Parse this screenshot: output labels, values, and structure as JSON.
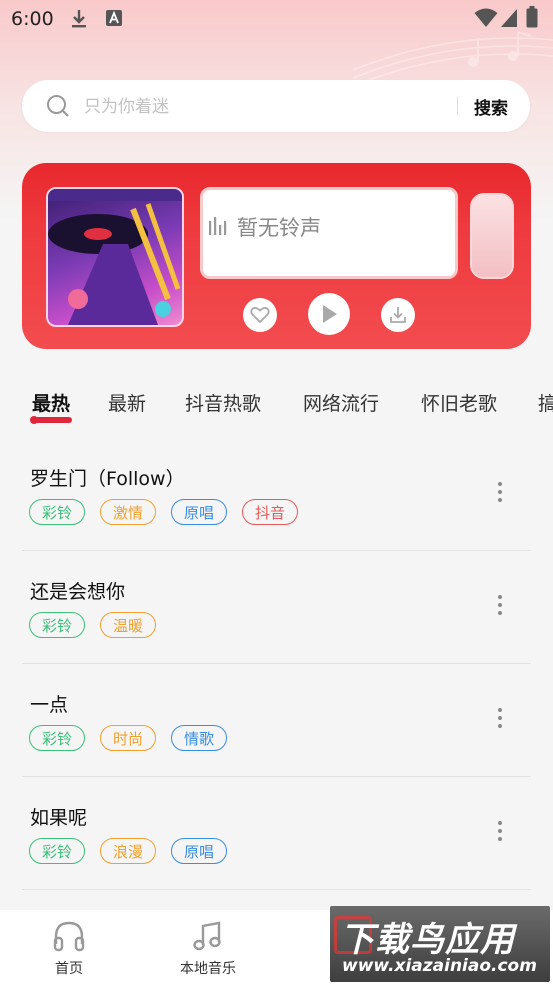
{
  "status": {
    "time": "6:00"
  },
  "search": {
    "placeholder": "只为你着迷",
    "button_label": "搜索"
  },
  "player": {
    "now_playing": "暂无铃声"
  },
  "tabs": [
    "最热",
    "最新",
    "抖音热歌",
    "网络流行",
    "怀旧老歌",
    "搞"
  ],
  "active_tab": 0,
  "songs": [
    {
      "title": "罗生门（Follow）",
      "tags": [
        "彩铃",
        "激情",
        "原唱",
        "抖音"
      ]
    },
    {
      "title": "还是会想你",
      "tags": [
        "彩铃",
        "温暖"
      ]
    },
    {
      "title": "一点",
      "tags": [
        "彩铃",
        "时尚",
        "情歌"
      ]
    },
    {
      "title": "如果呢",
      "tags": [
        "彩铃",
        "浪漫",
        "原唱"
      ]
    }
  ],
  "tag_colors": {
    "green": "#3cc07a",
    "orange": "#f0a030",
    "blue": "#3a8ee0",
    "red": "#e85a5a"
  },
  "bottom_nav": [
    {
      "label": "首页",
      "icon": "headphones-icon"
    },
    {
      "label": "本地音乐",
      "icon": "music-note-icon"
    }
  ],
  "watermark": {
    "main": "下载鸟应用",
    "sub": "www.xiazainiao.com"
  }
}
